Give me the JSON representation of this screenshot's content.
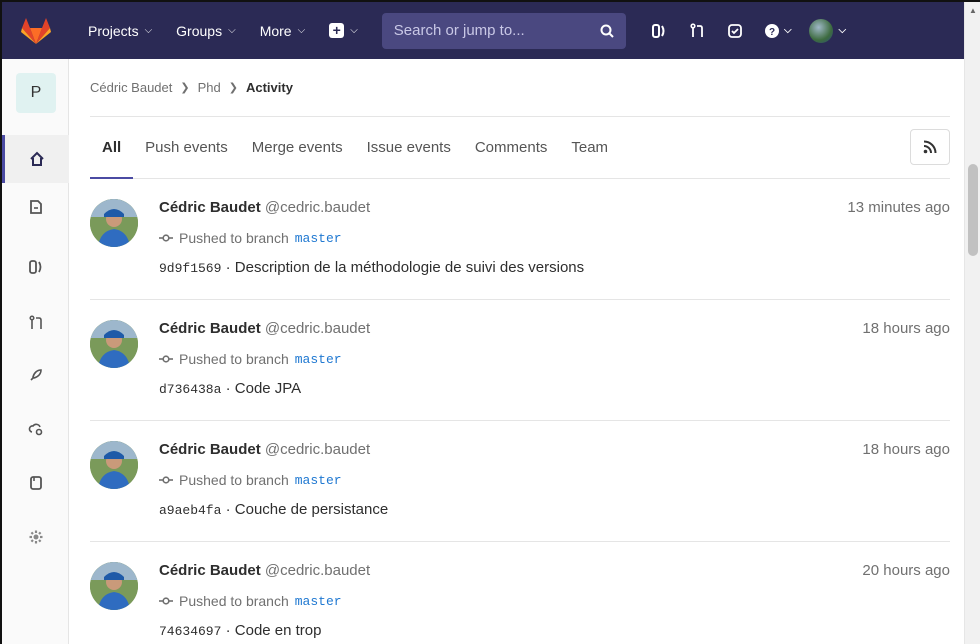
{
  "nav": {
    "projects": "Projects",
    "groups": "Groups",
    "more": "More",
    "search_placeholder": "Search or jump to..."
  },
  "sidebar": {
    "project_letter": "P"
  },
  "breadcrumb": {
    "user": "Cédric Baudet",
    "project": "Phd",
    "current": "Activity"
  },
  "tabs": [
    "All",
    "Push events",
    "Merge events",
    "Issue events",
    "Comments",
    "Team"
  ],
  "events": [
    {
      "name": "Cédric Baudet",
      "handle": "@cedric.baudet",
      "time": "13 minutes ago",
      "action": "Pushed to branch",
      "branch": "master",
      "sha": "9d9f1569",
      "message": "Description de la méthodologie de suivi des versions"
    },
    {
      "name": "Cédric Baudet",
      "handle": "@cedric.baudet",
      "time": "18 hours ago",
      "action": "Pushed to branch",
      "branch": "master",
      "sha": "d736438a",
      "message": "Code JPA"
    },
    {
      "name": "Cédric Baudet",
      "handle": "@cedric.baudet",
      "time": "18 hours ago",
      "action": "Pushed to branch",
      "branch": "master",
      "sha": "a9aeb4fa",
      "message": "Couche de persistance"
    },
    {
      "name": "Cédric Baudet",
      "handle": "@cedric.baudet",
      "time": "20 hours ago",
      "action": "Pushed to branch",
      "branch": "master",
      "sha": "74634697",
      "message": "Code en trop"
    }
  ],
  "separator": "·"
}
